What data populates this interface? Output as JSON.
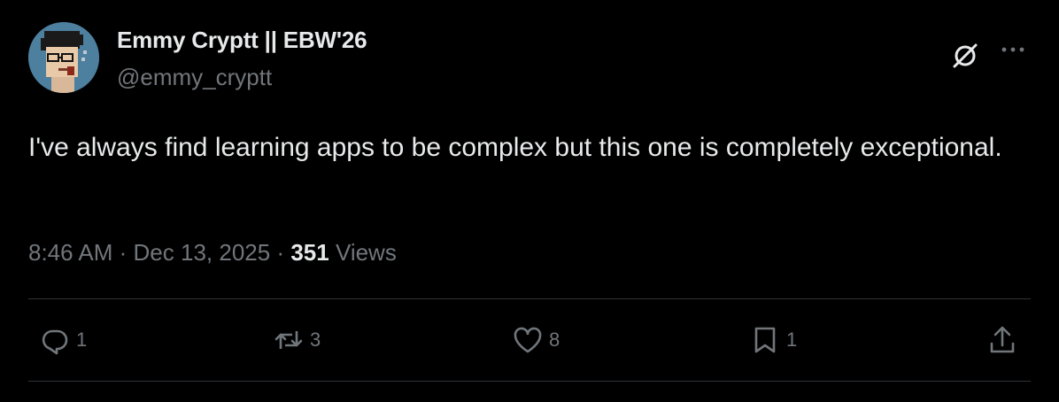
{
  "author": {
    "display_name": "Emmy Cryptt || EBW'26",
    "handle": "@emmy_cryptt"
  },
  "tweet": {
    "text": "I've always find learning apps to be complex but this one is completely exceptional.",
    "time": "8:46 AM",
    "date": "Dec 13, 2025",
    "views_count": "351",
    "views_label": "Views"
  },
  "actions": {
    "replies": "1",
    "reposts": "3",
    "likes": "8",
    "bookmarks": "1"
  },
  "icons": {
    "grok": "grok-icon",
    "more": "more-icon",
    "reply": "reply-icon",
    "repost": "repost-icon",
    "like": "heart-icon",
    "bookmark": "bookmark-icon",
    "share": "share-icon"
  },
  "colors": {
    "background": "#000000",
    "primary_text": "#e7e9ea",
    "secondary_text": "#71767b",
    "divider": "#2f3336"
  }
}
